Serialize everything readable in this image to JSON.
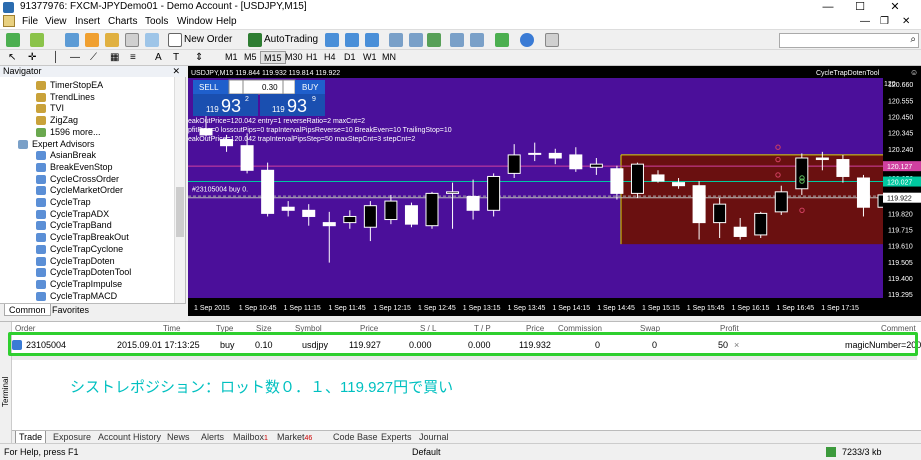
{
  "window": {
    "title": "91377976: FXCM-JPYDemo01 - Demo Account - [USDJPY,M15]"
  },
  "menu": [
    "File",
    "View",
    "Insert",
    "Charts",
    "Tools",
    "Window",
    "Help"
  ],
  "toolbar": {
    "new_order": "New Order",
    "autotrading": "AutoTrading"
  },
  "timeframes": [
    "M1",
    "M5",
    "M15",
    "M30",
    "H1",
    "H4",
    "D1",
    "W1",
    "MN"
  ],
  "active_timeframe": "M15",
  "navigator": {
    "title": "Navigator",
    "items": [
      {
        "label": "TimerStopEA",
        "kind": "ind"
      },
      {
        "label": "TrendLines",
        "kind": "ind"
      },
      {
        "label": "TVI",
        "kind": "ind"
      },
      {
        "label": "ZigZag",
        "kind": "ind"
      },
      {
        "label": "1596 more...",
        "kind": "more"
      },
      {
        "label": "Expert Advisors",
        "kind": "folder"
      },
      {
        "label": "AsianBreak",
        "kind": "ea"
      },
      {
        "label": "BreakEvenStop",
        "kind": "ea"
      },
      {
        "label": "CycleCrossOrder",
        "kind": "ea"
      },
      {
        "label": "CycleMarketOrder",
        "kind": "ea"
      },
      {
        "label": "CycleTrap",
        "kind": "ea"
      },
      {
        "label": "CycleTrapADX",
        "kind": "ea"
      },
      {
        "label": "CycleTrapBand",
        "kind": "ea"
      },
      {
        "label": "CycleTrapBreakOut",
        "kind": "ea"
      },
      {
        "label": "CycleTrapCyclone",
        "kind": "ea"
      },
      {
        "label": "CycleTrapDoten",
        "kind": "ea"
      },
      {
        "label": "CycleTrapDotenTool",
        "kind": "ea"
      },
      {
        "label": "CycleTrapImpulse",
        "kind": "ea"
      },
      {
        "label": "CycleTrapMACD",
        "kind": "ea"
      }
    ],
    "tabs": [
      "Common",
      "Favorites"
    ]
  },
  "chart": {
    "header": "USDJPY,M15  119.844 119.932 119.814 119.922",
    "ea_name": "CycleTrapDotenTool",
    "sell_label": "SELL",
    "buy_label": "BUY",
    "lot": "0.30",
    "bid_big": "93",
    "bid_small": "2",
    "bid_prefix": "119",
    "ask_big": "93",
    "ask_small": "9",
    "ask_prefix": "119",
    "info_lines": [
      "eakOutPrice=120.042 entry=1 reverseRatio=2 maxCnt=2",
      "pfitPips=0 losscutPips=0 trapIntervalPipsReverse=10 BreakEven=10 TrailingStop=10",
      "eakOutPrice=120.042 trapIntervalPipsStep=50 maxStepCnt=3 stepCnt=2"
    ],
    "order_line_label": "#23105004 buy 0.",
    "price_labels": [
      "120.660",
      "120.555",
      "120.450",
      "120.345",
      "120.240",
      "120.130",
      "120.050",
      "119.922",
      "119.820",
      "119.715",
      "119.610",
      "119.505",
      "119.400",
      "119.295"
    ],
    "price_tag_red": "120.127",
    "price_tag_teal": "120.027",
    "price_tag_current": "119.922",
    "top_right_price": "120.",
    "time_labels": [
      "1 Sep 2015",
      "1 Sep 10:45",
      "1 Sep 11:15",
      "1 Sep 11:45",
      "1 Sep 12:15",
      "1 Sep 12:45",
      "1 Sep 13:15",
      "1 Sep 13:45",
      "1 Sep 14:15",
      "1 Sep 14:45",
      "1 Sep 15:15",
      "1 Sep 15:45",
      "1 Sep 16:15",
      "1 Sep 16:45",
      "1 Sep 17:15"
    ],
    "colors": {
      "background": "#4b0f9a",
      "zone": "#6a1010",
      "zone_border": "#d8d800",
      "candle": "#ffffff",
      "bid_line": "#00c8a0"
    }
  },
  "chart_data": {
    "type": "candlestick",
    "symbol": "USDJPY,M15",
    "ylim": [
      119.27,
      120.7
    ],
    "candles": [
      {
        "o": 120.37,
        "h": 120.46,
        "l": 120.32,
        "c": 120.33
      },
      {
        "o": 120.3,
        "h": 120.33,
        "l": 120.22,
        "c": 120.26
      },
      {
        "o": 120.26,
        "h": 120.34,
        "l": 120.08,
        "c": 120.1
      },
      {
        "o": 120.1,
        "h": 120.15,
        "l": 119.8,
        "c": 119.82
      },
      {
        "o": 119.86,
        "h": 119.9,
        "l": 119.8,
        "c": 119.84
      },
      {
        "o": 119.84,
        "h": 119.88,
        "l": 119.74,
        "c": 119.8
      },
      {
        "o": 119.76,
        "h": 119.83,
        "l": 119.5,
        "c": 119.74
      },
      {
        "o": 119.76,
        "h": 119.84,
        "l": 119.72,
        "c": 119.8
      },
      {
        "o": 119.73,
        "h": 119.9,
        "l": 119.64,
        "c": 119.87
      },
      {
        "o": 119.78,
        "h": 119.94,
        "l": 119.75,
        "c": 119.9
      },
      {
        "o": 119.87,
        "h": 119.89,
        "l": 119.73,
        "c": 119.75
      },
      {
        "o": 119.74,
        "h": 119.96,
        "l": 119.72,
        "c": 119.95
      },
      {
        "o": 119.95,
        "h": 120.02,
        "l": 119.72,
        "c": 119.96
      },
      {
        "o": 119.93,
        "h": 120.04,
        "l": 119.78,
        "c": 119.84
      },
      {
        "o": 119.84,
        "h": 120.08,
        "l": 119.8,
        "c": 120.06
      },
      {
        "o": 120.08,
        "h": 120.27,
        "l": 120.05,
        "c": 120.2
      },
      {
        "o": 120.21,
        "h": 120.28,
        "l": 120.16,
        "c": 120.21
      },
      {
        "o": 120.21,
        "h": 120.24,
        "l": 120.14,
        "c": 120.18
      },
      {
        "o": 120.2,
        "h": 120.25,
        "l": 120.09,
        "c": 120.11
      },
      {
        "o": 120.12,
        "h": 120.18,
        "l": 120.07,
        "c": 120.14
      },
      {
        "o": 120.11,
        "h": 120.13,
        "l": 119.91,
        "c": 119.95
      },
      {
        "o": 119.95,
        "h": 120.15,
        "l": 119.92,
        "c": 120.14
      },
      {
        "o": 120.07,
        "h": 120.1,
        "l": 120.02,
        "c": 120.03
      },
      {
        "o": 120.02,
        "h": 120.05,
        "l": 119.98,
        "c": 120.0
      },
      {
        "o": 120.0,
        "h": 120.03,
        "l": 119.65,
        "c": 119.76
      },
      {
        "o": 119.76,
        "h": 119.92,
        "l": 119.66,
        "c": 119.88
      },
      {
        "o": 119.73,
        "h": 119.79,
        "l": 119.65,
        "c": 119.67
      },
      {
        "o": 119.68,
        "h": 119.83,
        "l": 119.66,
        "c": 119.82
      },
      {
        "o": 119.83,
        "h": 120.0,
        "l": 119.81,
        "c": 119.96
      },
      {
        "o": 119.98,
        "h": 120.21,
        "l": 119.94,
        "c": 120.18
      },
      {
        "o": 120.18,
        "h": 120.22,
        "l": 120.1,
        "c": 120.17
      },
      {
        "o": 120.17,
        "h": 120.2,
        "l": 120.02,
        "c": 120.06
      },
      {
        "o": 120.05,
        "h": 120.07,
        "l": 119.8,
        "c": 119.86
      },
      {
        "o": 119.86,
        "h": 119.97,
        "l": 119.85,
        "c": 119.94
      }
    ]
  },
  "terminal": {
    "label": "Terminal",
    "headers": [
      "Order",
      "Time",
      "Type",
      "Size",
      "Symbol",
      "Price",
      "S / L",
      "T / P",
      "Price",
      "Commission",
      "Swap",
      "Profit",
      "Comment"
    ],
    "order": {
      "ticket": "23105004",
      "time": "2015.09.01 17:13:25",
      "type": "buy",
      "size": "0.10",
      "symbol": "usdjpy",
      "price": "119.927",
      "sl": "0.000",
      "tp": "0.000",
      "cur_price": "119.932",
      "commission": "0",
      "swap": "0",
      "profit": "50",
      "close": "×",
      "comment": "magicNumber=2000"
    },
    "annotation": "シストレポジション：ロット数０．１、119.927円で買い",
    "tabs": [
      {
        "label": "Trade",
        "count": ""
      },
      {
        "label": "Exposure",
        "count": ""
      },
      {
        "label": "Account History",
        "count": ""
      },
      {
        "label": "News",
        "count": ""
      },
      {
        "label": "Alerts",
        "count": ""
      },
      {
        "label": "Mailbox",
        "count": "1"
      },
      {
        "label": "Market",
        "count": "46"
      },
      {
        "label": "Code Base",
        "count": ""
      },
      {
        "label": "Experts",
        "count": ""
      },
      {
        "label": "Journal",
        "count": ""
      }
    ]
  },
  "status": {
    "help": "For Help, press F1",
    "profile": "Default",
    "traffic": "7233/3 kb"
  }
}
